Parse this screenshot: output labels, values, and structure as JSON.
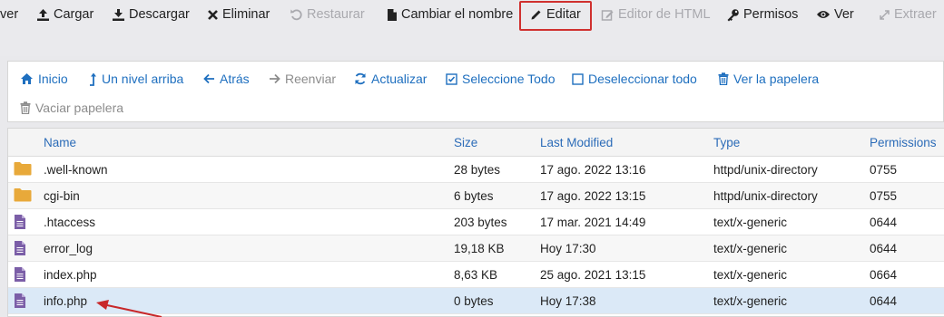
{
  "toolbar": {
    "ver_partial": "ver",
    "cargar": "Cargar",
    "descargar": "Descargar",
    "eliminar": "Eliminar",
    "restaurar": "Restaurar",
    "cambiar_nombre": "Cambiar el nombre",
    "editar": "Editar",
    "editor_html": "Editor de HTML",
    "permisos": "Permisos",
    "ver": "Ver",
    "extraer": "Extraer"
  },
  "nav": {
    "inicio": "Inicio",
    "nivel_arriba": "Un nivel arriba",
    "atras": "Atrás",
    "reenviar": "Reenviar",
    "actualizar": "Actualizar",
    "seleccione_todo": "Seleccione Todo",
    "deseleccionar_todo": "Deseleccionar todo",
    "ver_papelera": "Ver la papelera",
    "vaciar_papelera": "Vaciar papelera"
  },
  "table": {
    "headers": {
      "name": "Name",
      "size": "Size",
      "modified": "Last Modified",
      "type": "Type",
      "permissions": "Permissions"
    },
    "rows": [
      {
        "name": ".well-known",
        "size": "28 bytes",
        "modified": "17 ago. 2022 13:16",
        "type": "httpd/unix-directory",
        "perms": "0755",
        "kind": "folder"
      },
      {
        "name": "cgi-bin",
        "size": "6 bytes",
        "modified": "17 ago. 2022 13:15",
        "type": "httpd/unix-directory",
        "perms": "0755",
        "kind": "folder"
      },
      {
        "name": ".htaccess",
        "size": "203 bytes",
        "modified": "17 mar. 2021 14:49",
        "type": "text/x-generic",
        "perms": "0644",
        "kind": "file"
      },
      {
        "name": "error_log",
        "size": "19,18 KB",
        "modified": "Hoy 17:30",
        "type": "text/x-generic",
        "perms": "0644",
        "kind": "file"
      },
      {
        "name": "index.php",
        "size": "8,63 KB",
        "modified": "25 ago. 2021 13:15",
        "type": "text/x-generic",
        "perms": "0664",
        "kind": "file"
      },
      {
        "name": "info.php",
        "size": "0 bytes",
        "modified": "Hoy 17:38",
        "type": "text/x-generic",
        "perms": "0644",
        "kind": "file"
      }
    ]
  },
  "colors": {
    "link": "#1e6fbf",
    "folder": "#e8a93a",
    "file": "#7b5ea7",
    "highlight_box": "#d0302f",
    "selected_row": "#dbe9f7"
  }
}
